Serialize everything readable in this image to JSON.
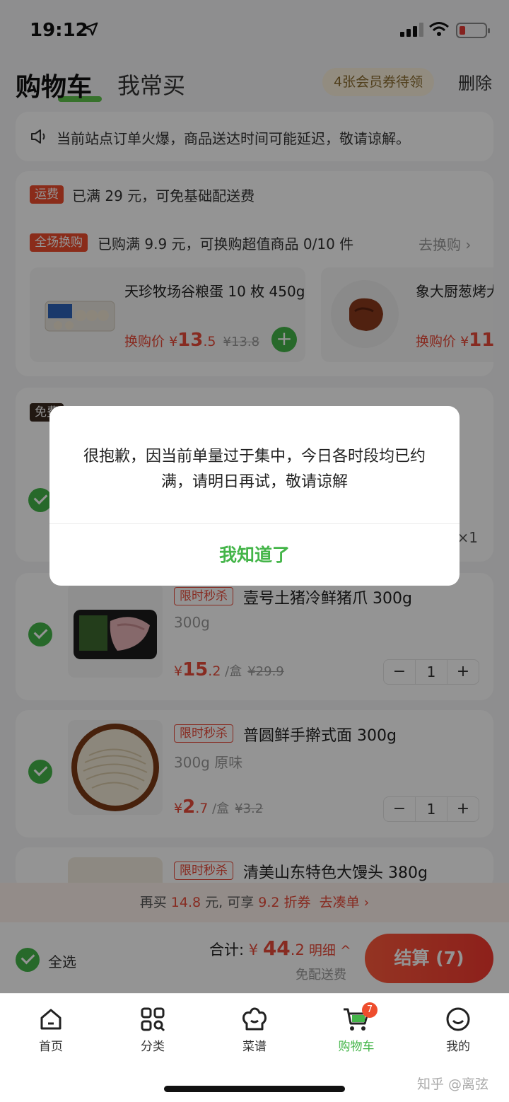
{
  "status_bar": {
    "time": "19:12"
  },
  "header": {
    "title": "购物车",
    "tab_frequent": "我常买",
    "coupon_badge": "4张会员券待领",
    "delete_label": "删除"
  },
  "notice": {
    "text": "当前站点订单火爆，商品送达时间可能延迟，敬请谅解。"
  },
  "promo": {
    "delivery_tag": "运费",
    "delivery_text": "已满 29 元，可免基础配送费",
    "swap_tag": "全场换购",
    "swap_text": "已购满 9.9 元，可换购超值商品 0/10 件",
    "swap_link": "去换购 ›",
    "swap_items": [
      {
        "name": "天珍牧场谷粮蛋 10 枚 450g",
        "price_label": "换购价",
        "currency": "¥",
        "price_int": "13",
        "price_dec": ".5",
        "orig_price": "¥13.8"
      },
      {
        "name": "象大厨葱烤大排",
        "price_label": "换购价",
        "currency": "¥",
        "price_int": "11",
        "price_dec": "",
        "orig_price": ""
      }
    ]
  },
  "group": {
    "tag": "免费",
    "qty": "×1"
  },
  "cart_items": [
    {
      "tag": "限时秒杀",
      "name": "壹号土猪冷鲜猪爪 300g",
      "spec": "300g",
      "currency": "¥",
      "price_int": "15",
      "price_dec": ".2",
      "unit": " /盒",
      "orig_price": "¥29.9",
      "quantity": "1"
    },
    {
      "tag": "限时秒杀",
      "name": "普圆鲜手擀式面 300g",
      "spec": "300g 原味",
      "currency": "¥",
      "price_int": "2",
      "price_dec": ".7",
      "unit": " /盒",
      "orig_price": "¥3.2",
      "quantity": "1"
    },
    {
      "tag": "限时秒杀",
      "name": "清美山东特色大馒头 380g",
      "spec": "",
      "currency": "¥",
      "price_int": "",
      "price_dec": "",
      "unit": "",
      "orig_price": "",
      "quantity": ""
    }
  ],
  "stepper": {
    "minus": "−",
    "plus": "+"
  },
  "upsell": {
    "prefix": "再买 ",
    "amount": "14.8",
    "middle": " 元, 可享 ",
    "discount": "9.2 折券",
    "link": "去凑单 ›"
  },
  "checkout": {
    "select_all": "全选",
    "total_label": "合计: ",
    "currency": "¥",
    "total_int": "44",
    "total_dec": ".2",
    "detail_link": " 明细 ^",
    "free_shipping": "免配送费",
    "pay_button": "结算 (7)"
  },
  "tabbar": {
    "items": [
      {
        "label": "首页",
        "icon": "home-icon"
      },
      {
        "label": "分类",
        "icon": "category-icon"
      },
      {
        "label": "菜谱",
        "icon": "chef-hat-icon"
      },
      {
        "label": "购物车",
        "icon": "cart-icon",
        "badge": "7"
      },
      {
        "label": "我的",
        "icon": "smiley-icon"
      }
    ]
  },
  "watermark": "知乎 @离弦",
  "dialog": {
    "message": "很抱歉，因当前单量过于集中，今日各时段均已约满，请明日再试，敬请谅解",
    "confirm": "我知道了"
  },
  "colors": {
    "brand_green": "#44b549",
    "price_red": "#e84a3a",
    "alert_red": "#ee4d2d"
  }
}
